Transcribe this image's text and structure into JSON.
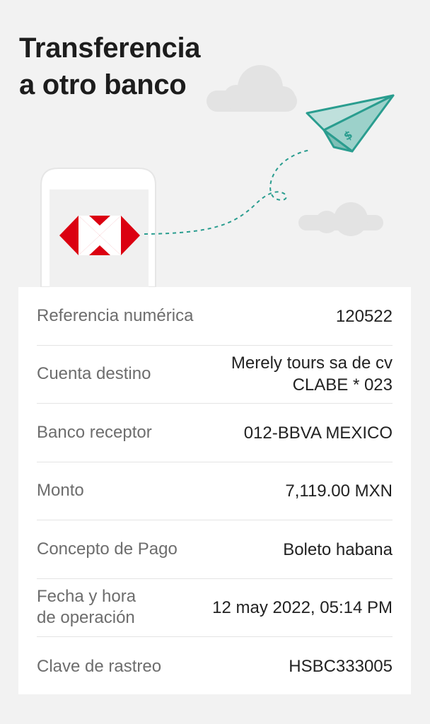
{
  "header": {
    "title_line1": "Transferencia",
    "title_line2": "a otro banco"
  },
  "colors": {
    "background": "#f2f2f2",
    "brand_red": "#db0011",
    "accent_teal": "#2a9d8f",
    "cloud": "#e2e2e2"
  },
  "details": [
    {
      "label": "Referencia numérica",
      "value": "120522"
    },
    {
      "label": "Cuenta destino",
      "value": "Merely tours sa de cv\nCLABE * 023"
    },
    {
      "label": "Banco receptor",
      "value": "012-BBVA MEXICO"
    },
    {
      "label": "Monto",
      "value": "7,119.00 MXN"
    },
    {
      "label": "Concepto de Pago",
      "value": "Boleto habana"
    },
    {
      "label": "Fecha y hora\nde operación",
      "value": "12 may 2022, 05:14 PM"
    },
    {
      "label": "Clave de rastreo",
      "value": "HSBC333005"
    }
  ]
}
